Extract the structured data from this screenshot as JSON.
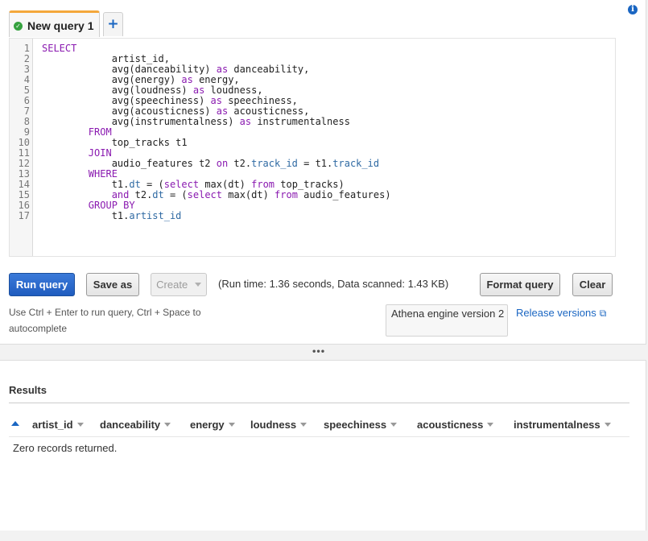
{
  "tabs": [
    {
      "label": "New query 1",
      "status_icon": "check-circle-icon"
    }
  ],
  "add_tab_label": "+",
  "info_label": "i",
  "editor": {
    "line_numbers": [
      "1",
      "2",
      "3",
      "4",
      "5",
      "6",
      "7",
      "8",
      "9",
      "10",
      "11",
      "12",
      "13",
      "14",
      "15",
      "16",
      "17"
    ],
    "lines": [
      [
        [
          "kw",
          "SELECT"
        ]
      ],
      [
        [
          "t",
          "            artist_id,"
        ]
      ],
      [
        [
          "t",
          "            avg(danceability) "
        ],
        [
          "kw",
          "as"
        ],
        [
          "t",
          " danceability,"
        ]
      ],
      [
        [
          "t",
          "            avg(energy) "
        ],
        [
          "kw",
          "as"
        ],
        [
          "t",
          " energy,"
        ]
      ],
      [
        [
          "t",
          "            avg(loudness) "
        ],
        [
          "kw",
          "as"
        ],
        [
          "t",
          " loudness,"
        ]
      ],
      [
        [
          "t",
          "            avg(speechiness) "
        ],
        [
          "kw",
          "as"
        ],
        [
          "t",
          " speechiness,"
        ]
      ],
      [
        [
          "t",
          "            avg(acousticness) "
        ],
        [
          "kw",
          "as"
        ],
        [
          "t",
          " acousticness,"
        ]
      ],
      [
        [
          "t",
          "            avg(instrumentalness) "
        ],
        [
          "kw",
          "as"
        ],
        [
          "t",
          " instrumentalness"
        ]
      ],
      [
        [
          "t",
          "        "
        ],
        [
          "kw",
          "FROM"
        ]
      ],
      [
        [
          "t",
          "            top_tracks t1"
        ]
      ],
      [
        [
          "t",
          "        "
        ],
        [
          "kw",
          "JOIN"
        ]
      ],
      [
        [
          "t",
          "            audio_features t2 "
        ],
        [
          "kw",
          "on"
        ],
        [
          "t",
          " t2."
        ],
        [
          "id",
          "track_id"
        ],
        [
          "t",
          " = t1."
        ],
        [
          "id",
          "track_id"
        ]
      ],
      [
        [
          "t",
          "        "
        ],
        [
          "kw",
          "WHERE"
        ]
      ],
      [
        [
          "t",
          "            t1."
        ],
        [
          "id",
          "dt"
        ],
        [
          "t",
          " = ("
        ],
        [
          "kw",
          "select"
        ],
        [
          "t",
          " max(dt) "
        ],
        [
          "kw",
          "from"
        ],
        [
          "t",
          " top_tracks)"
        ]
      ],
      [
        [
          "t",
          "            "
        ],
        [
          "kw",
          "and"
        ],
        [
          "t",
          " t2."
        ],
        [
          "id",
          "dt"
        ],
        [
          "t",
          " = ("
        ],
        [
          "kw",
          "select"
        ],
        [
          "t",
          " max(dt) "
        ],
        [
          "kw",
          "from"
        ],
        [
          "t",
          " audio_features)"
        ]
      ],
      [
        [
          "t",
          "        "
        ],
        [
          "kw",
          "GROUP BY"
        ]
      ],
      [
        [
          "t",
          "            t1."
        ],
        [
          "id",
          "artist_id"
        ]
      ]
    ]
  },
  "toolbar": {
    "run_label": "Run query",
    "save_label": "Save as",
    "create_label": "Create",
    "run_stats": "(Run time: 1.36 seconds, Data scanned: 1.43 KB)",
    "format_label": "Format query",
    "clear_label": "Clear"
  },
  "hint": "Use Ctrl + Enter to run query, Ctrl + Space to autocomplete",
  "engine_version": "Athena engine version 2",
  "release_link": "Release versions",
  "divider_handle": "•••",
  "results": {
    "title": "Results",
    "columns": [
      "artist_id",
      "danceability",
      "energy",
      "loudness",
      "speechiness",
      "acousticness",
      "instrumentalness"
    ],
    "empty_message": "Zero records returned."
  },
  "colors": {
    "accent": "#1a66c2",
    "tab_highlight": "#f4a73b",
    "keyword": "#8a1ab0",
    "identifier": "#2f6aa3",
    "success": "#36a23f"
  }
}
